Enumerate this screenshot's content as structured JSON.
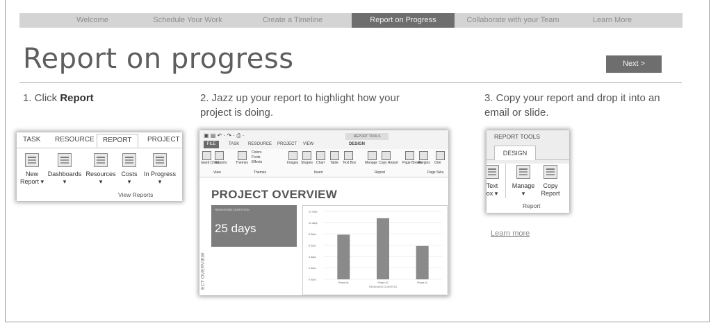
{
  "nav": {
    "items": [
      "Welcome",
      "Schedule Your Work",
      "Create a Timeline",
      "Report on Progress",
      "Collaborate with your Team",
      "Learn More"
    ]
  },
  "page": {
    "title": "Report on progress",
    "next_label": "Next >"
  },
  "steps": {
    "s1_prefix": "1. Click ",
    "s1_bold": "Report",
    "s2_line1": "2. Jazz up your report to highlight how your",
    "s2_line2": "project is doing.",
    "s3_line1": "3. Copy your report and drop it into an",
    "s3_line2": "email or slide."
  },
  "ribbon1": {
    "tabs": [
      "TASK",
      "RESOURCE",
      "REPORT",
      "PROJECT"
    ],
    "buttons": [
      {
        "label1": "New",
        "label2": "Report ▾"
      },
      {
        "label1": "Dashboards",
        "label2": "▾"
      },
      {
        "label1": "Resources",
        "label2": "▾"
      },
      {
        "label1": "Costs",
        "label2": "▾"
      },
      {
        "label1": "In Progress",
        "label2": "▾"
      }
    ],
    "group_label": "View Reports"
  },
  "ribbon2": {
    "file": "FILE",
    "tabs": [
      "TASK",
      "RESOURCE",
      "PROJECT",
      "VIEW",
      "DESIGN"
    ],
    "tools_label": "REPORT TOOLS",
    "buttons": [
      "Gantt Chart",
      "Reports",
      "Themes",
      "Colors",
      "Fonts",
      "Effects",
      "Images",
      "Shapes",
      "Chart",
      "Table",
      "Text Box",
      "Manage",
      "Copy Report",
      "Page Breaks",
      "Margins",
      "Orie"
    ],
    "groups": [
      "View",
      "Themes",
      "Insert",
      "Report",
      "Page Setu"
    ]
  },
  "overview": {
    "title": "PROJECT OVERVIEW",
    "box_small": "REMAINING DURATION",
    "days": "25 days",
    "side_label": "ECT OVERVIEW"
  },
  "chart_data": {
    "type": "bar",
    "categories": [
      "Phase #1",
      "Phase #2",
      "Phase #3"
    ],
    "values": [
      7.9,
      10.8,
      5.9
    ],
    "ylim": [
      0,
      12
    ],
    "yticks": [
      "0 days",
      "2 days",
      "4 days",
      "6 days",
      "8 days",
      "10 days",
      "12 days"
    ],
    "xlabel": "REMAINING DURATION",
    "ylabel": "",
    "title": "",
    "bar_color": "#8a8a8a",
    "grid": true
  },
  "ribbon3": {
    "tools_label": "REPORT TOOLS",
    "design_tab": "DESIGN",
    "text_label1": "Text",
    "text_label2": "ox ▾",
    "manage_label1": "Manage",
    "manage_label2": "▾",
    "copy_label1": "Copy",
    "copy_label2": "Report",
    "group_label": "Report"
  },
  "learn_more": "Learn more"
}
